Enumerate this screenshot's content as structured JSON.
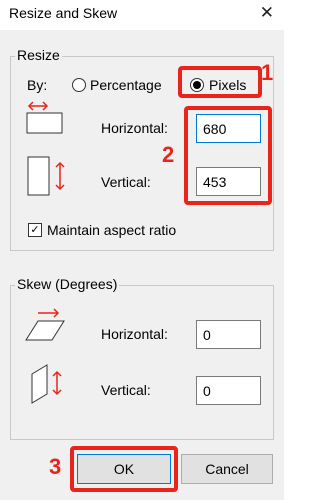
{
  "dialog": {
    "title": "Resize and Skew",
    "close_glyph": "✕"
  },
  "resize": {
    "group_label": "Resize",
    "by_label": "By:",
    "percentage_label": "Percentage",
    "pixels_label": "Pixels",
    "selected_mode": "Pixels",
    "horizontal_label": "Horizontal:",
    "horizontal_value": "680",
    "vertical_label": "Vertical:",
    "vertical_value": "453",
    "maintain_aspect_label": "Maintain aspect ratio",
    "maintain_aspect_checked": true,
    "checkmark_glyph": "✓"
  },
  "skew": {
    "group_label": "Skew (Degrees)",
    "horizontal_label": "Horizontal:",
    "horizontal_value": "0",
    "vertical_label": "Vertical:",
    "vertical_value": "0"
  },
  "buttons": {
    "ok_label": "OK",
    "cancel_label": "Cancel"
  },
  "annotations": {
    "step1": "1",
    "step2": "2",
    "step3": "3",
    "highlight_color": "#e8241b"
  },
  "icons": {
    "resize_horizontal": "resize-horizontal-icon",
    "resize_vertical": "resize-vertical-icon",
    "skew_horizontal": "skew-horizontal-icon",
    "skew_vertical": "skew-vertical-icon"
  }
}
